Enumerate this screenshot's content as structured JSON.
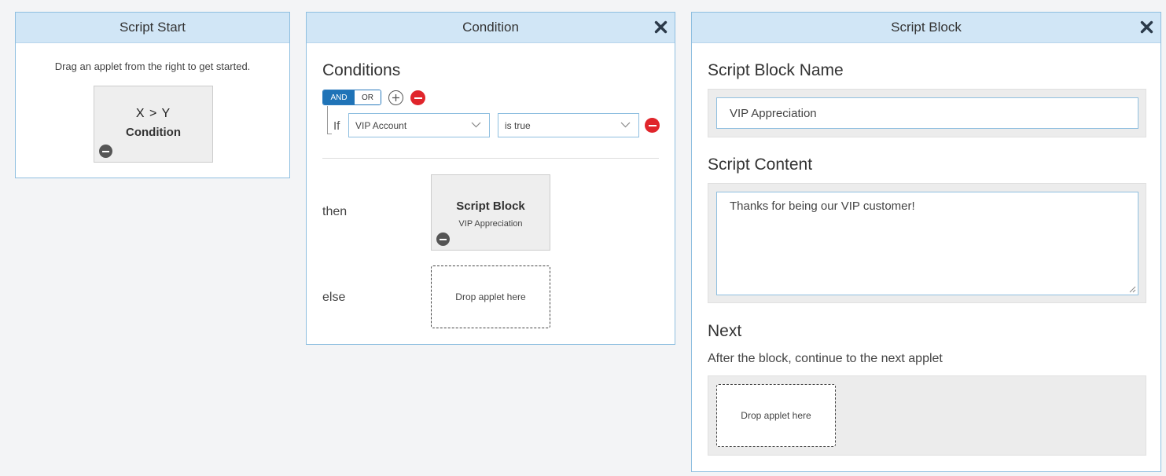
{
  "script_start": {
    "title": "Script Start",
    "hint": "Drag an applet from the right to get started.",
    "tile": {
      "symbol": "X > Y",
      "label": "Condition"
    }
  },
  "condition": {
    "title": "Condition",
    "heading": "Conditions",
    "and_label": "AND",
    "or_label": "OR",
    "if_label": "If",
    "field_select": "VIP Account",
    "operator_select": "is true",
    "then_label": "then",
    "else_label": "else",
    "then_tile": {
      "title": "Script Block",
      "subtitle": "VIP Appreciation"
    },
    "else_drop": "Drop applet here"
  },
  "script_block": {
    "title": "Script Block",
    "name_heading": "Script Block Name",
    "name_value": "VIP Appreciation",
    "content_heading": "Script Content",
    "content_value": "Thanks for being our VIP customer!",
    "next_heading": "Next",
    "next_sub": "After the block, continue to the next applet",
    "next_drop": "Drop applet here"
  },
  "colors": {
    "header_bg": "#d1e6f6",
    "panel_border": "#8fbfe0",
    "and_active": "#1f73b7",
    "remove_red": "#e0252b"
  }
}
